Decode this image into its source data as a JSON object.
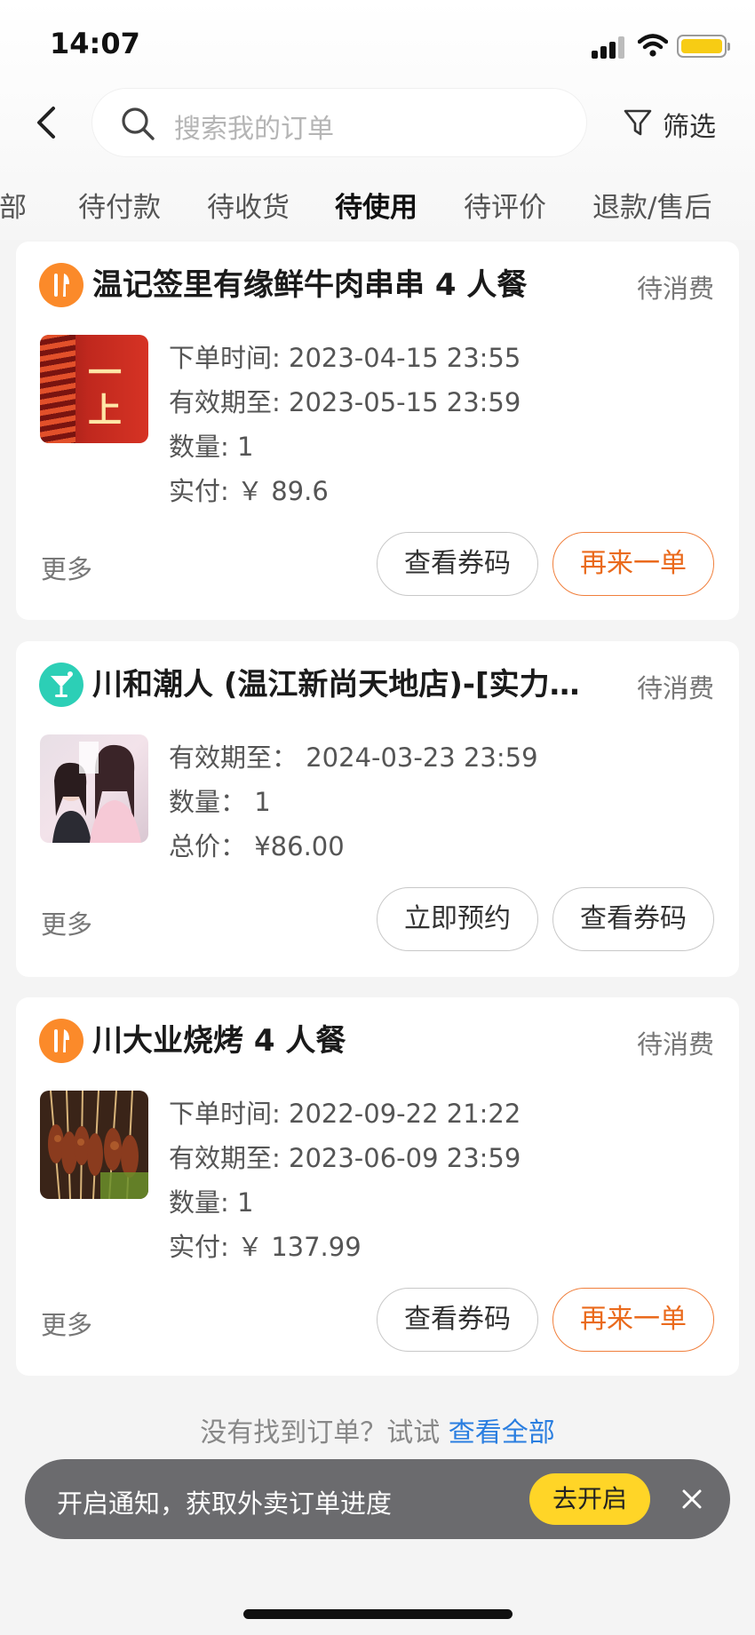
{
  "status_bar": {
    "time": "14:07"
  },
  "header": {
    "search_placeholder": "搜索我的订单",
    "filter_label": "筛选"
  },
  "tabs": [
    {
      "label": "全部"
    },
    {
      "label": "待付款"
    },
    {
      "label": "待收货"
    },
    {
      "label": "待使用",
      "active": true
    },
    {
      "label": "待评价"
    },
    {
      "label": "退款/售后"
    }
  ],
  "orders": [
    {
      "shop_icon": "restaurant-icon",
      "name": "温记签里有缘鲜牛肉串串 4 人餐",
      "status": "待消费",
      "details": [
        "下单时间: 2023-04-15 23:55",
        "有效期至: 2023-05-15 23:59",
        "数量: 1",
        "实付: ￥ 89.6"
      ],
      "thumb_text": "一 上",
      "more": "更多",
      "buttons": [
        "查看券码",
        "再来一单"
      ]
    },
    {
      "shop_icon": "cocktail-icon",
      "name": "川和潮人 (温江新尚天地店)-[实力…",
      "status": "待消费",
      "details": [
        "有效期至： 2024-03-23 23:59",
        "数量： 1",
        "总价： ¥86.00"
      ],
      "more": "更多",
      "buttons": [
        "立即预约",
        "查看券码"
      ]
    },
    {
      "shop_icon": "restaurant-icon",
      "name": "川大业烧烤 4 人餐",
      "status": "待消费",
      "details": [
        "下单时间: 2022-09-22 21:22",
        "有效期至: 2023-06-09 23:59",
        "数量: 1",
        "实付: ￥ 137.99"
      ],
      "more": "更多",
      "buttons": [
        "查看券码",
        "再来一单"
      ]
    }
  ],
  "footer": {
    "hint": "没有找到订单？试试",
    "link": "查看全部"
  },
  "notification": {
    "text": "开启通知，获取外卖订单进度",
    "button": "去开启"
  },
  "colors": {
    "accent_yellow": "#ffd11a",
    "accent_orange": "#ea6a1c",
    "link_blue": "#2a7ee0"
  }
}
